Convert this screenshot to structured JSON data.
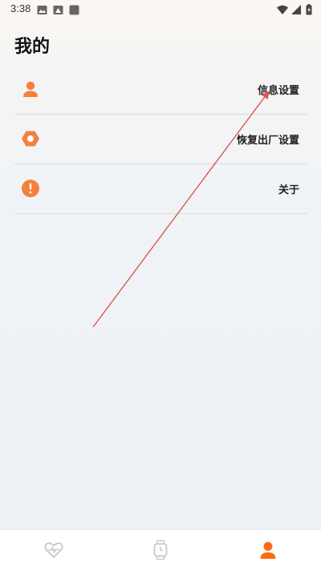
{
  "status_bar": {
    "time": "3:38",
    "icons": [
      "image-icon",
      "photo-icon",
      "app-icon",
      "wifi-icon",
      "signal-icon",
      "battery-icon"
    ]
  },
  "page": {
    "title": "我的"
  },
  "menu": {
    "items": [
      {
        "label": "信息设置",
        "icon": "user-icon"
      },
      {
        "label": "恢复出厂设置",
        "icon": "hexagon-nut-icon"
      },
      {
        "label": "关于",
        "icon": "info-alert-icon"
      }
    ]
  },
  "bottom_nav": {
    "tabs": [
      {
        "icon": "heart-pulse-icon",
        "active": false
      },
      {
        "icon": "watch-icon",
        "active": false
      },
      {
        "icon": "user-icon",
        "active": true
      }
    ]
  },
  "colors": {
    "accent": "#f5803d",
    "active_tab": "#ff6a13",
    "inactive_tab": "#c8c8c8",
    "annotation_arrow": "#e05555"
  }
}
